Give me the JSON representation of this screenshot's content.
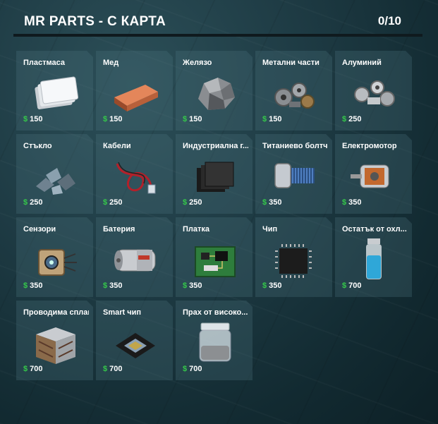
{
  "header": {
    "title": "MR PARTS - C КАРТА",
    "counter": "0/10"
  },
  "currency_symbol": "$",
  "colors": {
    "currency": "#35c84a",
    "card_bg": "#3d5c64",
    "text": "#ffffff"
  },
  "items": [
    {
      "name": "Пластмаса",
      "price": "150",
      "icon": "plastic-sheets-icon"
    },
    {
      "name": "Мед",
      "price": "150",
      "icon": "copper-ingot-icon"
    },
    {
      "name": "Желязо",
      "price": "150",
      "icon": "iron-ore-icon"
    },
    {
      "name": "Метални части",
      "price": "150",
      "icon": "metal-parts-icon"
    },
    {
      "name": "Алуминий",
      "price": "250",
      "icon": "aluminium-scrap-icon"
    },
    {
      "name": "Стъкло",
      "price": "250",
      "icon": "glass-shards-icon"
    },
    {
      "name": "Кабели",
      "price": "250",
      "icon": "cable-icon"
    },
    {
      "name": "Индустриална г...",
      "price": "250",
      "icon": "rubber-sheets-icon"
    },
    {
      "name": "Титаниево болтче",
      "price": "350",
      "icon": "titanium-bolt-icon"
    },
    {
      "name": "Електромотор",
      "price": "350",
      "icon": "electric-motor-icon"
    },
    {
      "name": "Сензори",
      "price": "350",
      "icon": "sensor-icon"
    },
    {
      "name": "Батерия",
      "price": "350",
      "icon": "battery-icon"
    },
    {
      "name": "Платка",
      "price": "350",
      "icon": "circuit-board-icon"
    },
    {
      "name": "Чип",
      "price": "350",
      "icon": "chip-icon"
    },
    {
      "name": "Остатък от охл...",
      "price": "700",
      "icon": "coolant-vial-icon"
    },
    {
      "name": "Проводима сплав",
      "price": "700",
      "icon": "alloy-cube-icon"
    },
    {
      "name": "Smart чип",
      "price": "700",
      "icon": "smart-chip-icon"
    },
    {
      "name": "Прах от високо...",
      "price": "700",
      "icon": "powder-jar-icon"
    }
  ]
}
